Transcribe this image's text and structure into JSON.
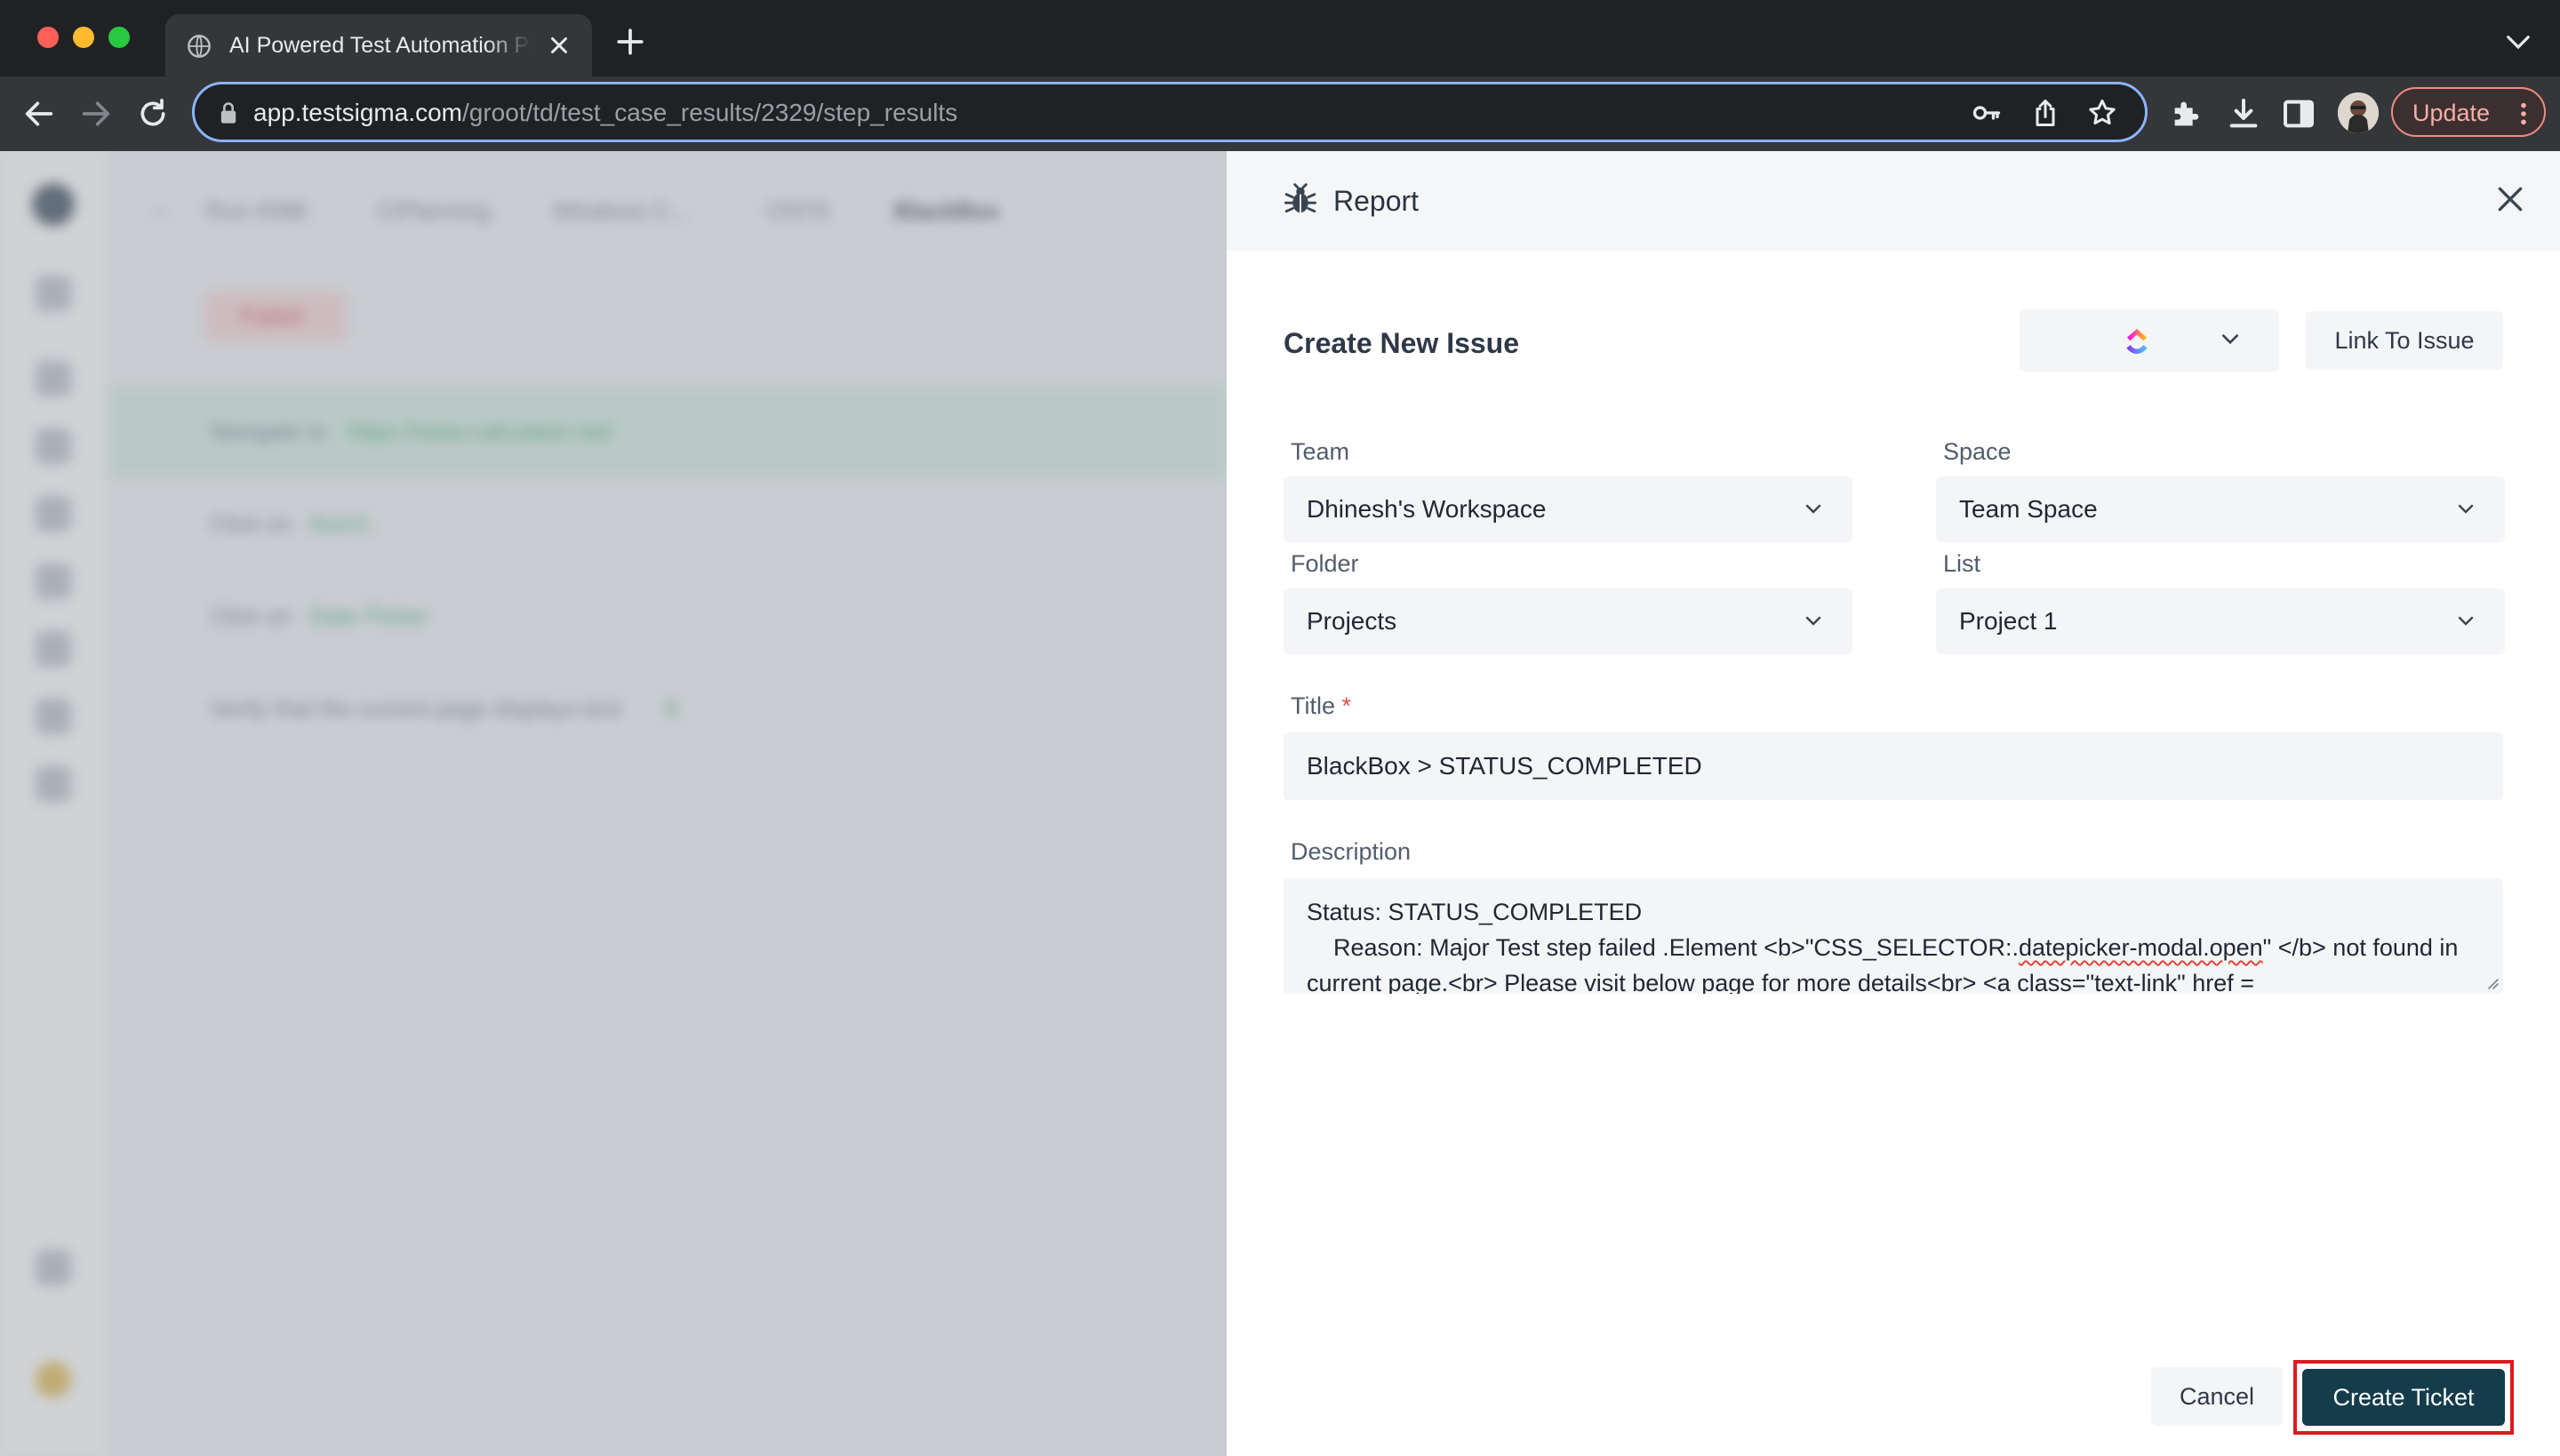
{
  "browser": {
    "tab_title": "AI Powered Test Automation Platform",
    "url_host": "app.testsigma.com",
    "url_path": "/groot/td/test_case_results/2329/step_results",
    "update_label": "Update"
  },
  "drawer": {
    "title": "Report",
    "section_title": "Create New Issue",
    "link_label": "Link To Issue",
    "fields": {
      "team": {
        "label": "Team",
        "value": "Dhinesh's Workspace"
      },
      "space": {
        "label": "Space",
        "value": "Team Space"
      },
      "folder": {
        "label": "Folder",
        "value": "Projects"
      },
      "list": {
        "label": "List",
        "value": "Project 1"
      },
      "title": {
        "label": "Title",
        "required_mark": "*",
        "value": "BlackBox > STATUS_COMPLETED"
      },
      "description": {
        "label": "Description",
        "line1": "Status: STATUS_COMPLETED",
        "line2_prefix": "    Reason: Major Test step failed .Element <b>\"CSS_SELECTOR:.",
        "line2_flagged": "datepicker-modal.open",
        "line2_suffix": "\" </b> not found in current page.<br> Please visit below page for more details<br> <a class=\"text-link\" href ="
      }
    },
    "cancel_label": "Cancel",
    "create_label": "Create Ticket"
  },
  "background": {
    "breadcrumb": [
      "Run #598",
      "CIPlanning",
      "Windows C...",
      "CNTS",
      "BlackBox"
    ],
    "status_chip": "Failed",
    "steps": [
      {
        "prefix": "Navigate to",
        "value": "https://www.calculator.net/"
      },
      {
        "prefix": "Click on",
        "value": "Num1"
      },
      {
        "prefix": "Click on",
        "value": "Date Picker"
      },
      {
        "prefix": "Verify that the current page displays text",
        "value": "8"
      }
    ]
  },
  "colors": {
    "primary_button": "#143c4a",
    "highlight_frame": "#e0191f",
    "omnibox_focus": "#8ab4f8"
  }
}
